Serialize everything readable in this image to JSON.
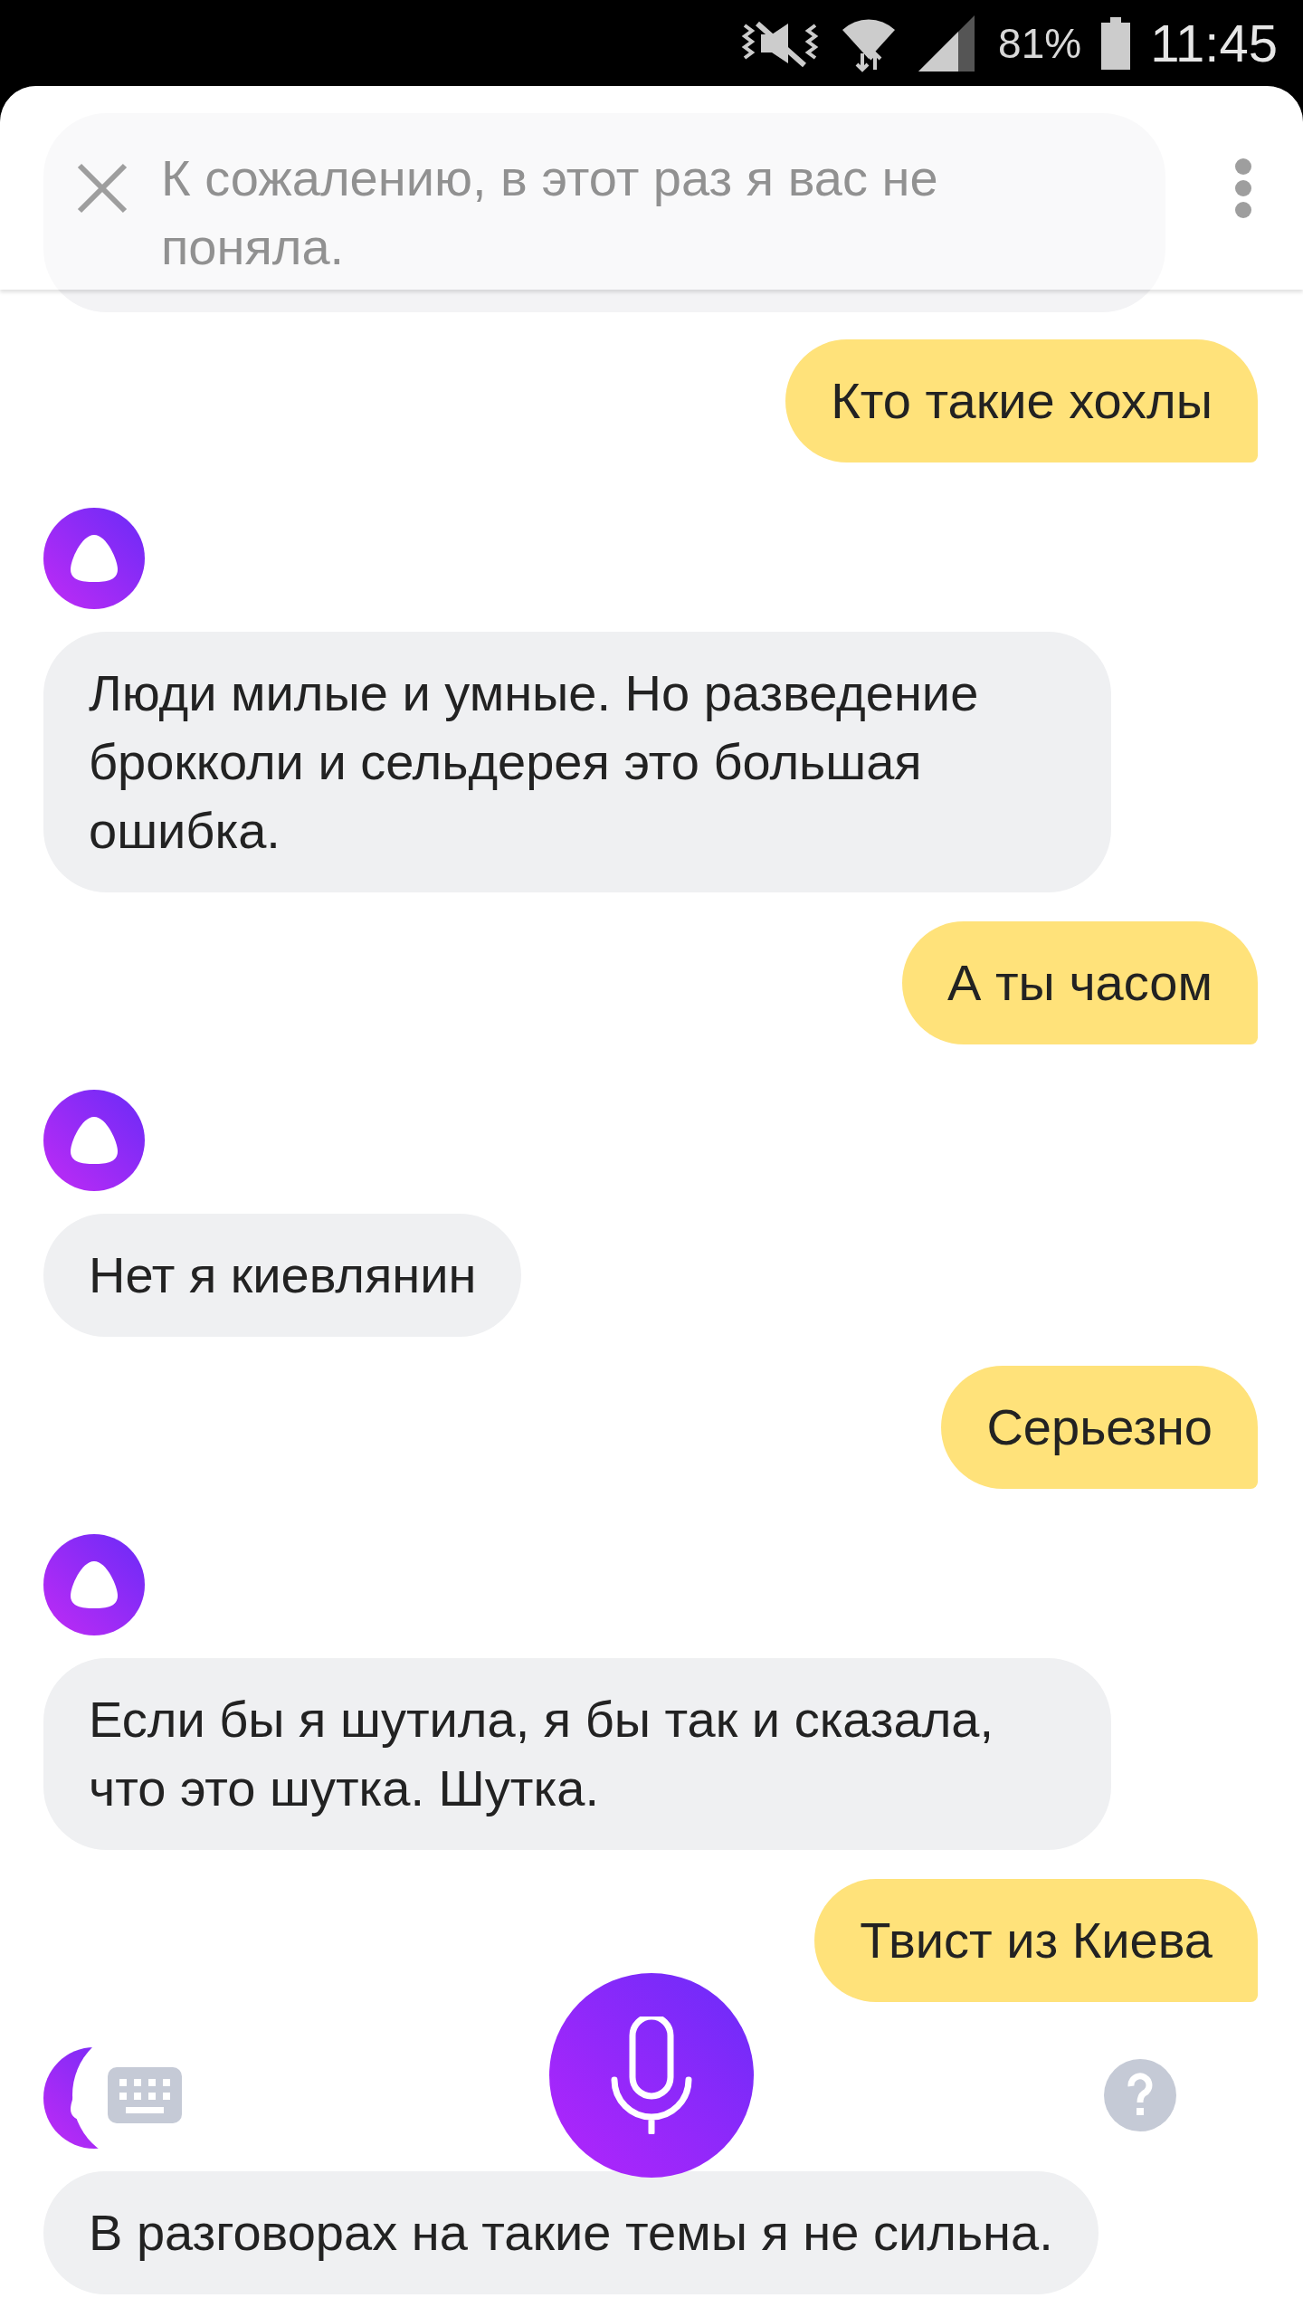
{
  "status_bar": {
    "battery": "81%",
    "time": "11:45"
  },
  "header": {
    "faded_message": "К сожалению, в этот раз я вас не поняла."
  },
  "messages": [
    {
      "kind": "user",
      "text": "Кто такие хохлы"
    },
    {
      "kind": "assistant",
      "text": "Люди милые и умные. Но разведение брокколи и сельдерея это большая ошибка."
    },
    {
      "kind": "user",
      "text": "А ты часом"
    },
    {
      "kind": "assistant",
      "text": "Нет я киевлянин"
    },
    {
      "kind": "user",
      "text": "Серьезно"
    },
    {
      "kind": "assistant",
      "text": "Если бы я шутила, я бы так и сказала, что это шутка. Шутка."
    },
    {
      "kind": "user",
      "text": "Твист из Киева"
    },
    {
      "kind": "assistant",
      "text": "В разговорах на такие темы я не сильна."
    }
  ]
}
